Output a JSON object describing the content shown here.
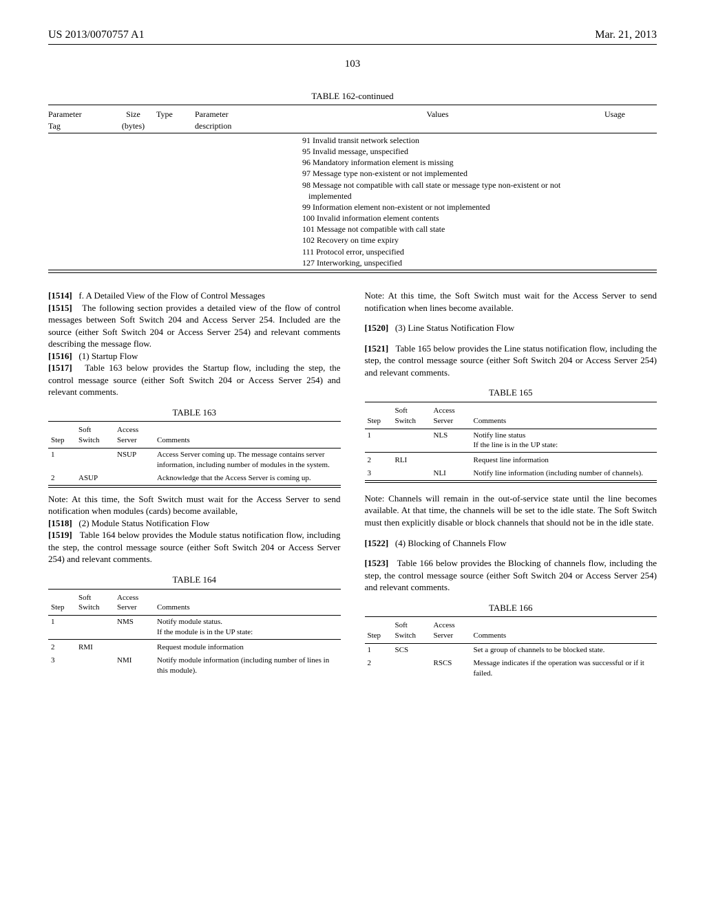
{
  "header": {
    "docId": "US 2013/0070757 A1",
    "date": "Mar. 21, 2013"
  },
  "pageNumber": "103",
  "table162": {
    "title": "TABLE 162-continued",
    "headers": {
      "paramTag": "Parameter\nTag",
      "size": "Size\n(bytes)",
      "type": "Type",
      "paramDesc": "Parameter\ndescription",
      "values": "Values",
      "usage": "Usage"
    },
    "values": [
      "  91 Invalid transit network selection",
      "  95 Invalid message, unspecified",
      "  96 Mandatory information element is missing",
      "  97 Message type non-existent or not implemented",
      "  98 Message not compatible with call state or message type non-existent or not implemented",
      "  99 Information element non-existent or not implemented",
      "100 Invalid information element contents",
      "101 Message not compatible with call state",
      "102 Recovery on time expiry",
      "111 Protocol error, unspecified",
      "127 Interworking, unspecified"
    ]
  },
  "left": {
    "p1514": {
      "num": "[1514]",
      "text": "f. A Detailed View of the Flow of Control Messages"
    },
    "p1515": {
      "num": "[1515]",
      "text": "The following section provides a detailed view of the flow of control messages between Soft Switch 204 and Access Server 254. Included are the source (either Soft Switch 204 or Access Server 254) and relevant comments describing the message flow."
    },
    "p1516": {
      "num": "[1516]",
      "text": "(1) Startup Flow"
    },
    "p1517": {
      "num": "[1517]",
      "text": "Table 163 below provides the Startup flow, including the step, the control message source (either Soft Switch 204 or Access Server 254) and relevant comments."
    },
    "table163": {
      "title": "TABLE 163",
      "headers": {
        "step": "Step",
        "ss": "Soft\nSwitch",
        "as": "Access\nServer",
        "comments": "Comments"
      },
      "rows": [
        {
          "step": "1",
          "ss": "",
          "as": "NSUP",
          "comments": "Access Server coming up. The message contains server information, including number of modules in the system."
        },
        {
          "step": "2",
          "ss": "ASUP",
          "as": "",
          "comments": "Acknowledge that the Access Server is coming up."
        }
      ]
    },
    "note163": "Note: At this time, the Soft Switch must wait for the Access Server to send notification when modules (cards) become available,",
    "p1518": {
      "num": "[1518]",
      "text": "(2) Module Status Notification Flow"
    },
    "p1519": {
      "num": "[1519]",
      "text": "Table 164 below provides the Module status notification flow, including the step, the control message source (either Soft Switch 204 or Access Server 254) and relevant comments."
    },
    "table164": {
      "title": "TABLE 164",
      "headers": {
        "step": "Step",
        "ss": "Soft\nSwitch",
        "as": "Access\nServer",
        "comments": "Comments"
      },
      "rows": [
        {
          "step": "1",
          "ss": "",
          "as": "NMS",
          "comments": "Notify module status.\nIf the module is in the UP state:"
        },
        {
          "step": "2",
          "ss": "RMI",
          "as": "",
          "comments": "Request module information"
        },
        {
          "step": "3",
          "ss": "",
          "as": "NMI",
          "comments": "Notify module information (including number of lines in this module)."
        }
      ]
    }
  },
  "right": {
    "note164": "Note: At this time, the Soft Switch must wait for the Access Server to send notification when lines become available.",
    "p1520": {
      "num": "[1520]",
      "text": "(3) Line Status Notification Flow"
    },
    "p1521": {
      "num": "[1521]",
      "text": "Table 165 below provides the Line status notification flow, including the step, the control message source (either Soft Switch 204 or Access Server 254) and relevant comments."
    },
    "table165": {
      "title": "TABLE 165",
      "headers": {
        "step": "Step",
        "ss": "Soft\nSwitch",
        "as": "Access\nServer",
        "comments": "Comments"
      },
      "rows": [
        {
          "step": "1",
          "ss": "",
          "as": "NLS",
          "comments": "Notify line status\nIf the line is in the UP state:"
        },
        {
          "step": "2",
          "ss": "RLI",
          "as": "",
          "comments": "Request line information"
        },
        {
          "step": "3",
          "ss": "",
          "as": "NLI",
          "comments": "Notify line information (including number of channels)."
        }
      ]
    },
    "note165": "Note: Channels will remain in the out-of-service state until the line becomes available. At that time, the channels will be set to the idle state. The Soft Switch must then explicitly disable or block channels that should not be in the idle state.",
    "p1522": {
      "num": "[1522]",
      "text": "(4) Blocking of Channels Flow"
    },
    "p1523": {
      "num": "[1523]",
      "text": "Table 166 below provides the Blocking of channels flow, including the step, the control message source (either Soft Switch 204 or Access Server 254) and relevant comments."
    },
    "table166": {
      "title": "TABLE 166",
      "headers": {
        "step": "Step",
        "ss": "Soft\nSwitch",
        "as": "Access\nServer",
        "comments": "Comments"
      },
      "rows": [
        {
          "step": "1",
          "ss": "SCS",
          "as": "",
          "comments": "Set a group of channels to be blocked state."
        },
        {
          "step": "2",
          "ss": "",
          "as": "RSCS",
          "comments": "Message indicates if the operation was successful or if it failed."
        }
      ]
    }
  }
}
